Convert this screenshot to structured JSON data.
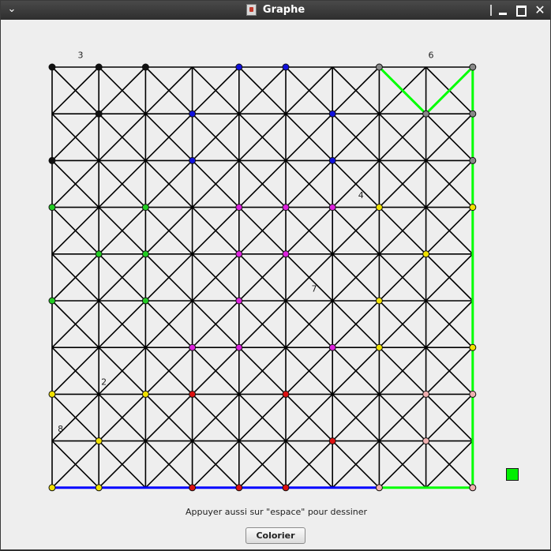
{
  "window": {
    "title": "Graphe"
  },
  "hint_text": "Appuyer aussi sur \"espace\" pour dessiner",
  "button_label": "Colorier",
  "swatch_color": "#00ee00",
  "colors": {
    "edge": "#000000",
    "green_edge": "#00ff00",
    "blue_edge": "#0000ff",
    "black": "#111111",
    "blue": "#1010dd",
    "gray": "#888888",
    "green": "#22cc22",
    "magenta": "#dd22dd",
    "yellow": "#f2e200",
    "red": "#dd1111",
    "pink": "#f0b0b0"
  },
  "graph": {
    "nodes": [
      [
        "black",
        0,
        0
      ],
      [
        "black",
        1,
        0
      ],
      [
        "black",
        2,
        0
      ],
      [
        "blue",
        4,
        0
      ],
      [
        "blue",
        5,
        0
      ],
      [
        "gray",
        7,
        0
      ],
      [
        "gray",
        9,
        0
      ],
      [
        "black",
        1,
        1
      ],
      [
        "blue",
        3,
        1
      ],
      [
        "blue",
        6,
        1
      ],
      [
        "gray",
        8,
        1
      ],
      [
        "gray",
        9,
        1
      ],
      [
        "black",
        0,
        2
      ],
      [
        "blue",
        3,
        2
      ],
      [
        "blue",
        6,
        2
      ],
      [
        "gray",
        9,
        2
      ],
      [
        "green",
        0,
        3
      ],
      [
        "green",
        2,
        3
      ],
      [
        "magenta",
        4,
        3
      ],
      [
        "magenta",
        5,
        3
      ],
      [
        "magenta",
        6,
        3
      ],
      [
        "yellow",
        7,
        3
      ],
      [
        "yellow",
        9,
        3
      ],
      [
        "green",
        1,
        4
      ],
      [
        "green",
        2,
        4
      ],
      [
        "magenta",
        4,
        4
      ],
      [
        "magenta",
        5,
        4
      ],
      [
        "yellow",
        8,
        4
      ],
      [
        "green",
        0,
        5
      ],
      [
        "green",
        2,
        5
      ],
      [
        "magenta",
        4,
        5
      ],
      [
        "yellow",
        7,
        5
      ],
      [
        "magenta",
        3,
        6
      ],
      [
        "magenta",
        4,
        6
      ],
      [
        "magenta",
        6,
        6
      ],
      [
        "yellow",
        7,
        6
      ],
      [
        "yellow",
        9,
        6
      ],
      [
        "yellow",
        0,
        7
      ],
      [
        "yellow",
        2,
        7
      ],
      [
        "red",
        3,
        7
      ],
      [
        "red",
        5,
        7
      ],
      [
        "pink",
        8,
        7
      ],
      [
        "pink",
        9,
        7
      ],
      [
        "yellow",
        1,
        8
      ],
      [
        "red",
        6,
        8
      ],
      [
        "pink",
        8,
        8
      ],
      [
        "yellow",
        0,
        9
      ],
      [
        "yellow",
        1,
        9
      ],
      [
        "red",
        3,
        9
      ],
      [
        "red",
        4,
        9
      ],
      [
        "red",
        5,
        9
      ],
      [
        "pink",
        7,
        9
      ],
      [
        "pink",
        9,
        9
      ]
    ],
    "green_path": [
      [
        7,
        0
      ],
      [
        8,
        1
      ],
      [
        9,
        0
      ],
      [
        9,
        9
      ],
      [
        7,
        9
      ]
    ],
    "blue_path": [
      [
        0,
        9
      ],
      [
        7,
        9
      ]
    ],
    "labels": [
      [
        "3",
        0.55,
        -0.13
      ],
      [
        "6",
        8.05,
        -0.13
      ],
      [
        "4",
        6.55,
        2.87
      ],
      [
        "7",
        5.55,
        4.87
      ],
      [
        "2",
        1.05,
        6.87
      ],
      [
        "8",
        0.12,
        7.87
      ]
    ]
  }
}
